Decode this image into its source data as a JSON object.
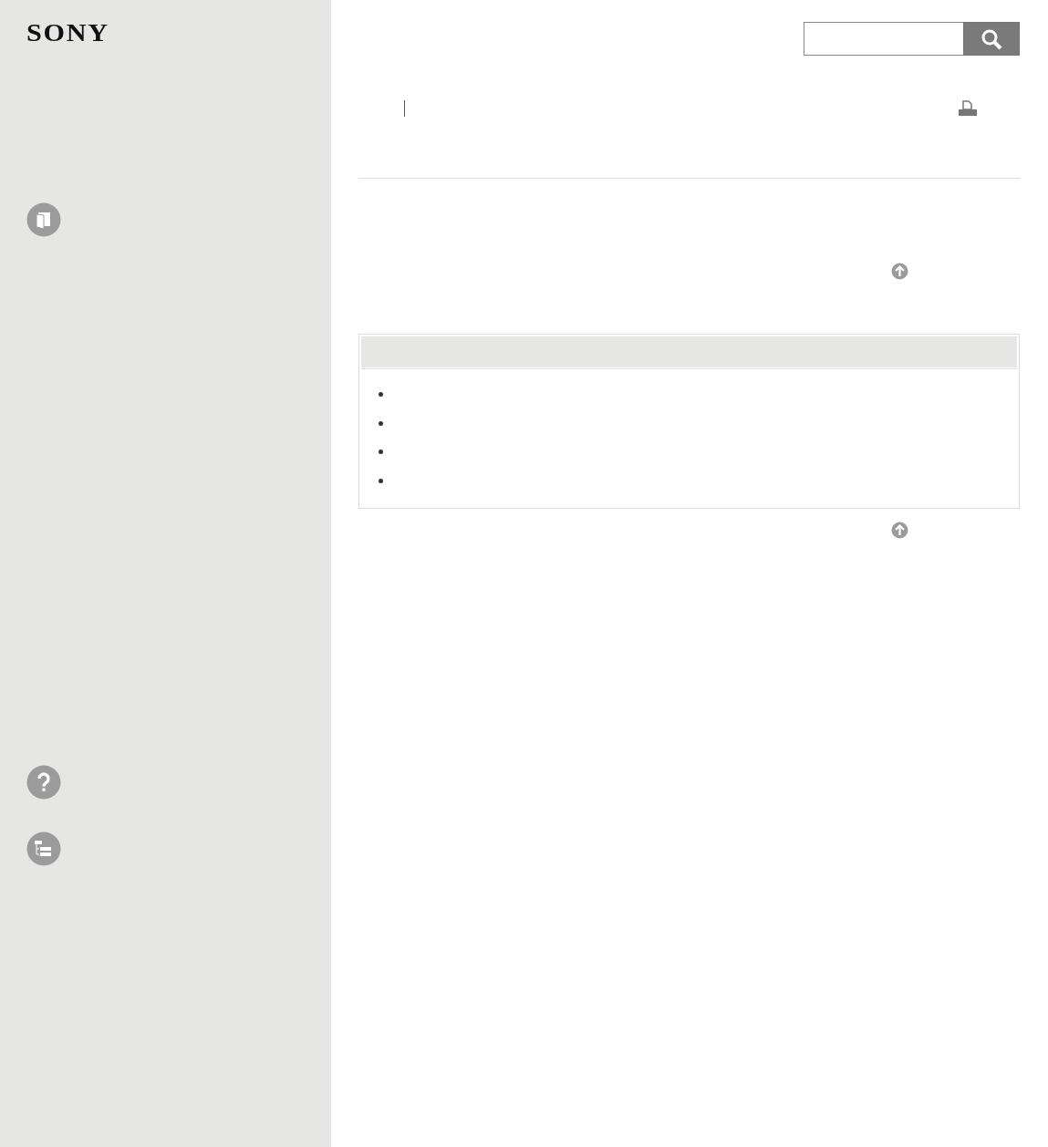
{
  "logo": "SONY",
  "sidebar": {
    "icons": [
      {
        "kind": "book"
      },
      {
        "kind": "help"
      },
      {
        "kind": "tree"
      }
    ]
  },
  "content": {
    "list_items": [
      {
        "kind": "bullet"
      },
      {
        "kind": "bullet"
      },
      {
        "kind": "bullet"
      },
      {
        "kind": "bullet"
      }
    ]
  }
}
